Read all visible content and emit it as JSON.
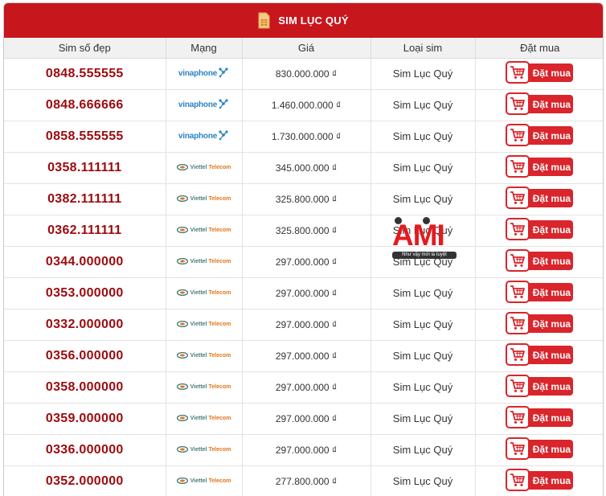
{
  "header": {
    "title": "SIM LỤC QUÝ",
    "icon": "sim-card-icon"
  },
  "columns": {
    "number": "Sim số đẹp",
    "network": "Mạng",
    "price": "Giá",
    "type": "Loại sim",
    "buy": "Đặt mua"
  },
  "logos": {
    "vinaphone": "vinaphone",
    "viettel_name": "Viettel",
    "viettel_tel": "Telecom"
  },
  "rows": [
    {
      "number": "0848.555555",
      "network": "vinaphone",
      "price": "830.000.000 ₫",
      "type": "Sim Lục Quý",
      "buy": "Đặt mua"
    },
    {
      "number": "0848.666666",
      "network": "vinaphone",
      "price": "1.460.000.000 ₫",
      "type": "Sim Lục Quý",
      "buy": "Đặt mua"
    },
    {
      "number": "0858.555555",
      "network": "vinaphone",
      "price": "1.730.000.000 ₫",
      "type": "Sim Lục Quý",
      "buy": "Đặt mua"
    },
    {
      "number": "0358.111111",
      "network": "viettel",
      "price": "345.000.000 ₫",
      "type": "Sim Lục Quý",
      "buy": "Đặt mua"
    },
    {
      "number": "0382.111111",
      "network": "viettel",
      "price": "325.800.000 ₫",
      "type": "Sim Lục Quý",
      "buy": "Đặt mua"
    },
    {
      "number": "0362.111111",
      "network": "viettel",
      "price": "325.800.000 ₫",
      "type": "Sim Lục Quý",
      "buy": "Đặt mua"
    },
    {
      "number": "0344.000000",
      "network": "viettel",
      "price": "297.000.000 ₫",
      "type": "Sim Lục Quý",
      "buy": "Đặt mua"
    },
    {
      "number": "0353.000000",
      "network": "viettel",
      "price": "297.000.000 ₫",
      "type": "Sim Lục Quý",
      "buy": "Đặt mua"
    },
    {
      "number": "0332.000000",
      "network": "viettel",
      "price": "297.000.000 ₫",
      "type": "Sim Lục Quý",
      "buy": "Đặt mua"
    },
    {
      "number": "0356.000000",
      "network": "viettel",
      "price": "297.000.000 ₫",
      "type": "Sim Lục Quý",
      "buy": "Đặt mua"
    },
    {
      "number": "0358.000000",
      "network": "viettel",
      "price": "297.000.000 ₫",
      "type": "Sim Lục Quý",
      "buy": "Đặt mua"
    },
    {
      "number": "0359.000000",
      "network": "viettel",
      "price": "297.000.000 ₫",
      "type": "Sim Lục Quý",
      "buy": "Đặt mua"
    },
    {
      "number": "0336.000000",
      "network": "viettel",
      "price": "297.000.000 ₫",
      "type": "Sim Lục Quý",
      "buy": "Đặt mua"
    },
    {
      "number": "0352.000000",
      "network": "viettel",
      "price": "277.800.000 ₫",
      "type": "Sim Lục Quý",
      "buy": "Đặt mua"
    }
  ],
  "watermark": {
    "logo_text": "AMI",
    "tagline": "Như vậy mới là tuyệt"
  },
  "colors": {
    "header_bg": "#c8161d",
    "number_text": "#9c0a0e",
    "buy_button": "#d9252b",
    "vinaphone_blue": "#2a84c4",
    "viettel_orange": "#e1751a"
  }
}
